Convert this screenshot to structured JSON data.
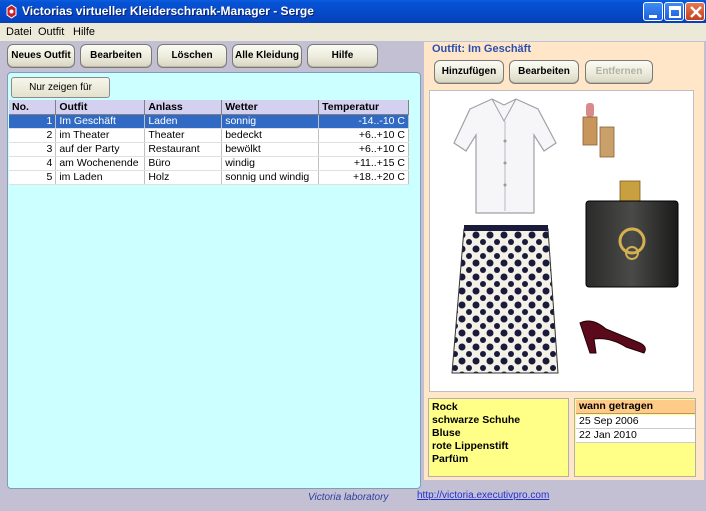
{
  "window": {
    "title": "Victorias virtueller Kleiderschrank-Manager - Serge"
  },
  "menu": [
    "Datei",
    "Outfit",
    "Hilfe"
  ],
  "toolbar": {
    "new_outfit": "Neues Outfit",
    "edit": "Bearbeiten",
    "delete": "Löschen",
    "all_clothes": "Alle Kleidung",
    "help": "Hilfe"
  },
  "filter": {
    "label": "Nur zeigen für"
  },
  "table": {
    "columns": [
      "No.",
      "Outfit",
      "Anlass",
      "Wetter",
      "Temperatur"
    ],
    "rows": [
      {
        "no": "1",
        "outfit": "Im Geschäft",
        "occasion": "Laden",
        "weather": "sonnig",
        "temp": "-14..-10 C",
        "selected": true
      },
      {
        "no": "2",
        "outfit": "im Theater",
        "occasion": "Theater",
        "weather": "bedeckt",
        "temp": "+6..+10 C"
      },
      {
        "no": "3",
        "outfit": "auf der Party",
        "occasion": "Restaurant",
        "weather": "bewölkt",
        "temp": "+6..+10 C"
      },
      {
        "no": "4",
        "outfit": "am Wochenende",
        "occasion": "Büro",
        "weather": "windig",
        "temp": "+11..+15 C"
      },
      {
        "no": "5",
        "outfit": "im Laden",
        "occasion": "Holz",
        "weather": "sonnig und windig",
        "temp": "+18..+20 C"
      }
    ]
  },
  "outfit_panel": {
    "header": "Outfit: Im Geschäft",
    "add": "Hinzufügen",
    "edit": "Bearbeiten",
    "remove": "Entfernen",
    "items": [
      "Rock",
      "schwarze Schuhe",
      "Bluse",
      "rote Lippenstift",
      "Parfüm"
    ],
    "worn_header": "wann getragen",
    "worn_dates": [
      "25 Sep 2006",
      "22 Jan 2010"
    ]
  },
  "footer": {
    "lab": "Victoria laboratory",
    "url": "http://victoria.executivpro.com"
  },
  "colors": {
    "title_bar": "#0648c8",
    "selected_row": "#316ac5",
    "table_bg": "#ccffff",
    "right_panel": "#ffe6c8",
    "note_yellow": "#ffff88"
  }
}
